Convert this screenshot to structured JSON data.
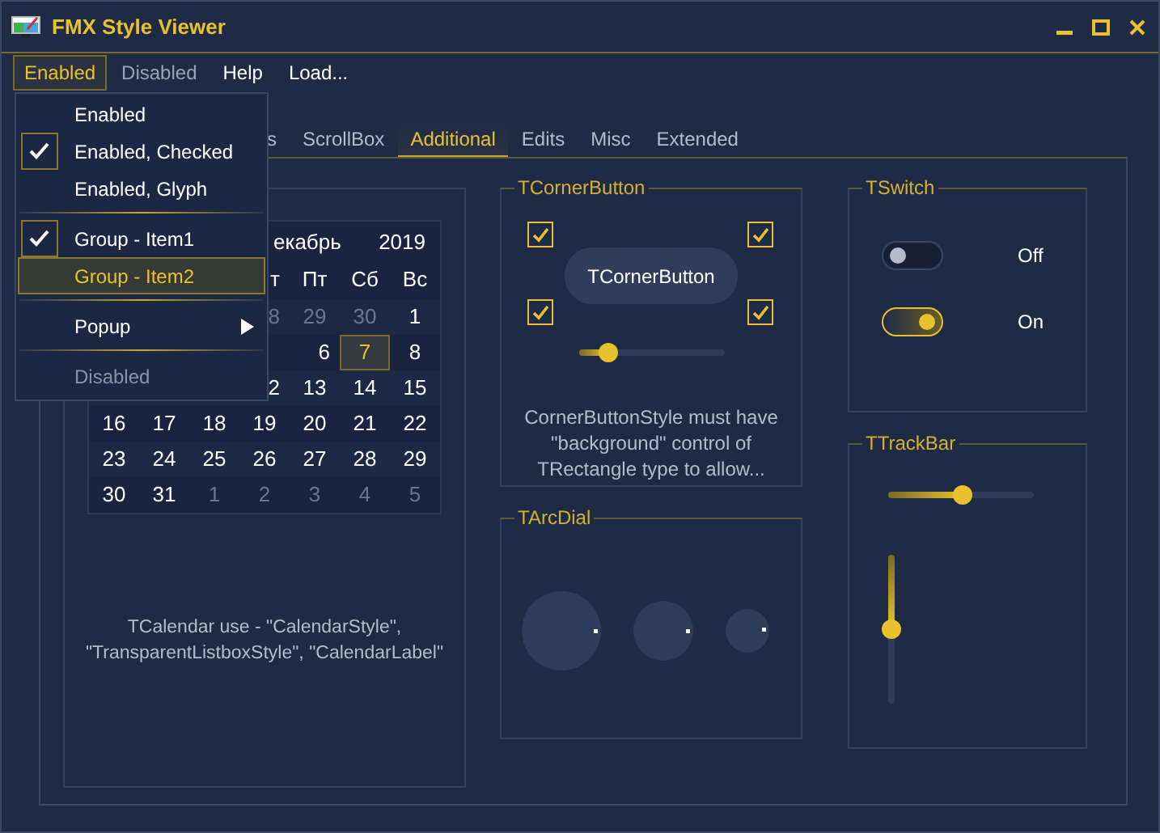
{
  "window": {
    "title": "FMX Style Viewer"
  },
  "menu_bar": [
    {
      "label": "Enabled",
      "selected": true,
      "disabled": false
    },
    {
      "label": "Disabled",
      "selected": false,
      "disabled": true
    },
    {
      "label": "Help",
      "selected": false,
      "disabled": false
    },
    {
      "label": "Load...",
      "selected": false,
      "disabled": false
    }
  ],
  "dropdown": [
    {
      "kind": "item",
      "label": "Enabled",
      "checked": false,
      "selected": false,
      "disabled": false
    },
    {
      "kind": "item",
      "label": "Enabled, Checked",
      "checked": true,
      "selected": false,
      "disabled": false
    },
    {
      "kind": "item",
      "label": "Enabled, Glyph",
      "checked": false,
      "selected": false,
      "disabled": false
    },
    {
      "kind": "separator"
    },
    {
      "kind": "item",
      "label": "Group - Item1",
      "checked": true,
      "selected": false,
      "disabled": false
    },
    {
      "kind": "item",
      "label": "Group - Item2",
      "checked": false,
      "selected": true,
      "disabled": false
    },
    {
      "kind": "separator"
    },
    {
      "kind": "submenu",
      "label": "Popup",
      "checked": false,
      "selected": false,
      "disabled": false
    },
    {
      "kind": "separator"
    },
    {
      "kind": "item",
      "label": "Disabled",
      "checked": false,
      "selected": false,
      "disabled": true
    }
  ],
  "tabs": [
    {
      "label": "s",
      "selected": false
    },
    {
      "label": "ScrollBox",
      "selected": false
    },
    {
      "label": "Additional",
      "selected": true
    },
    {
      "label": "Edits",
      "selected": false
    },
    {
      "label": "Misc",
      "selected": false
    },
    {
      "label": "Extended",
      "selected": false
    }
  ],
  "calendar": {
    "month": "екабрь",
    "year": "2019",
    "weekdays": [
      "т",
      "Пт",
      "Сб",
      "Вс"
    ],
    "weeks": [
      [
        {
          "text": "8",
          "muted": true,
          "selected": false
        },
        {
          "text": "29",
          "muted": true,
          "selected": false
        },
        {
          "text": "30",
          "muted": true,
          "selected": false
        },
        {
          "text": "1",
          "muted": false,
          "selected": false
        }
      ],
      [
        {
          "text": "6",
          "muted": false,
          "selected": false
        },
        {
          "text": "7",
          "muted": false,
          "selected": true
        },
        {
          "text": "8",
          "muted": false,
          "selected": false
        }
      ],
      [
        {
          "text": "2",
          "muted": false,
          "selected": false
        },
        {
          "text": "13",
          "muted": false,
          "selected": false
        },
        {
          "text": "14",
          "muted": false,
          "selected": false
        },
        {
          "text": "15",
          "muted": false,
          "selected": false
        }
      ],
      [
        {
          "text": "16",
          "muted": false,
          "selected": false
        },
        {
          "text": "17",
          "muted": false,
          "selected": false
        },
        {
          "text": "18",
          "muted": false,
          "selected": false
        },
        {
          "text": "19",
          "muted": false,
          "selected": false
        },
        {
          "text": "20",
          "muted": false,
          "selected": false
        },
        {
          "text": "21",
          "muted": false,
          "selected": false
        },
        {
          "text": "22",
          "muted": false,
          "selected": false
        }
      ],
      [
        {
          "text": "23",
          "muted": false,
          "selected": false
        },
        {
          "text": "24",
          "muted": false,
          "selected": false
        },
        {
          "text": "25",
          "muted": false,
          "selected": false
        },
        {
          "text": "26",
          "muted": false,
          "selected": false
        },
        {
          "text": "27",
          "muted": false,
          "selected": false
        },
        {
          "text": "28",
          "muted": false,
          "selected": false
        },
        {
          "text": "29",
          "muted": false,
          "selected": false
        }
      ],
      [
        {
          "text": "30",
          "muted": false,
          "selected": false
        },
        {
          "text": "31",
          "muted": false,
          "selected": false
        },
        {
          "text": "1",
          "muted": true,
          "selected": false
        },
        {
          "text": "2",
          "muted": true,
          "selected": false
        },
        {
          "text": "3",
          "muted": true,
          "selected": false
        },
        {
          "text": "4",
          "muted": true,
          "selected": false
        },
        {
          "text": "5",
          "muted": true,
          "selected": false
        }
      ]
    ],
    "note": "TCalendar use - \"CalendarStyle\", \"TransparentListboxStyle\", \"CalendarLabel\""
  },
  "corner_button": {
    "title": "TCornerButton",
    "checkboxes": [
      {
        "checked": true
      },
      {
        "checked": true
      },
      {
        "checked": true
      },
      {
        "checked": true
      }
    ],
    "button": "TCornerButton",
    "slider": {
      "level": 0.21
    },
    "note": "CornerButtonStyle must have \"background\" control of TRectangle type to allow..."
  },
  "arc_dial": {
    "title": "TArcDial"
  },
  "switch": {
    "title": "TSwitch",
    "switches": [
      {
        "on": false,
        "label": "Off"
      },
      {
        "on": true,
        "label": "On"
      }
    ]
  },
  "trackbar": {
    "title": "TTrackBar",
    "horizontal": {
      "level": 0.51
    },
    "vertical": {
      "level": 0.5
    }
  }
}
